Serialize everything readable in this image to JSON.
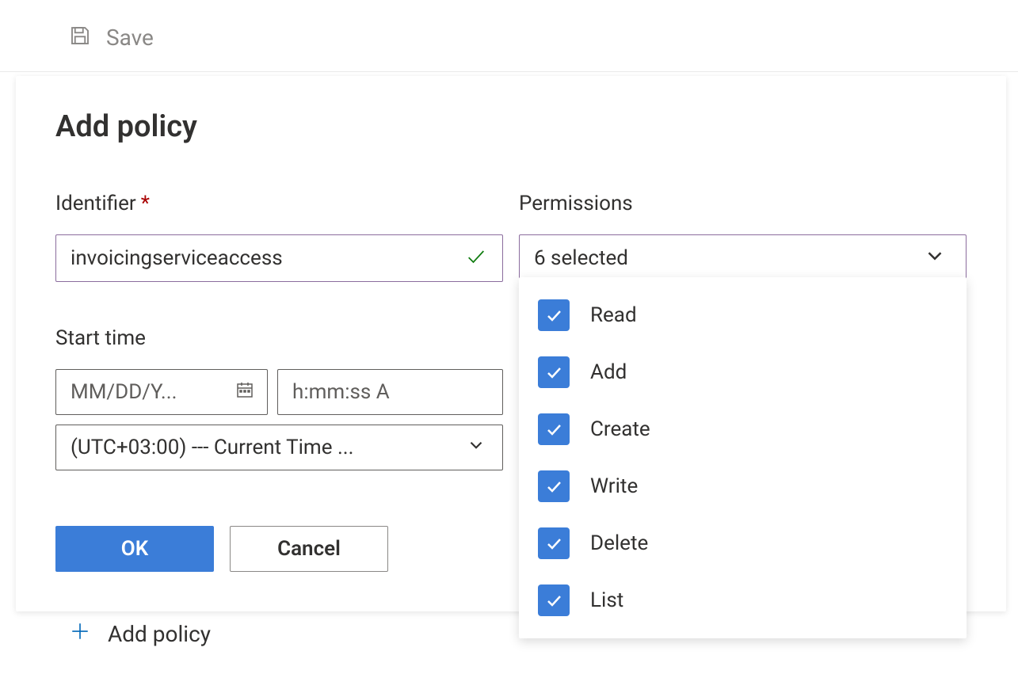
{
  "toolbar": {
    "save_label": "Save"
  },
  "panel": {
    "title": "Add policy",
    "identifier_label": "Identifier",
    "identifier_value": "invoicingserviceaccess",
    "start_time_label": "Start time",
    "date_placeholder": "MM/DD/Y...",
    "time_placeholder": "h:mm:ss A",
    "tz_value": "(UTC+03:00) --- Current Time ...",
    "permissions_label": "Permissions",
    "permissions_selected": "6 selected",
    "permissions_options": [
      {
        "label": "Read",
        "checked": true
      },
      {
        "label": "Add",
        "checked": true
      },
      {
        "label": "Create",
        "checked": true
      },
      {
        "label": "Write",
        "checked": true
      },
      {
        "label": "Delete",
        "checked": true
      },
      {
        "label": "List",
        "checked": true
      }
    ],
    "ok_label": "OK",
    "cancel_label": "Cancel"
  },
  "underlay": {
    "add_policy_label": "Add policy"
  }
}
